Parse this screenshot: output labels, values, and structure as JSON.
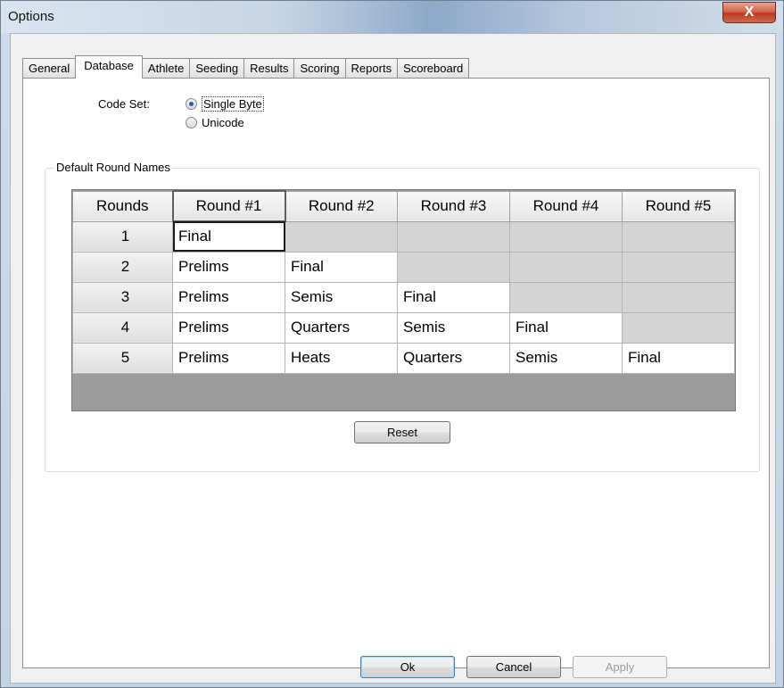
{
  "window": {
    "title": "Options",
    "close_glyph": "X"
  },
  "tabs": [
    {
      "label": "General"
    },
    {
      "label": "Database",
      "active": true
    },
    {
      "label": "Athlete"
    },
    {
      "label": "Seeding"
    },
    {
      "label": "Results"
    },
    {
      "label": "Scoring"
    },
    {
      "label": "Reports"
    },
    {
      "label": "Scoreboard"
    }
  ],
  "database": {
    "code_set_label": "Code Set:",
    "options": [
      {
        "label": "Single Byte",
        "checked": true
      },
      {
        "label": "Unicode",
        "checked": false
      }
    ],
    "group_title": "Default Round Names",
    "grid": {
      "headers": [
        "Rounds",
        "Round #1",
        "Round #2",
        "Round #3",
        "Round #4",
        "Round #5"
      ],
      "rows": [
        {
          "rounds": "1",
          "cells": [
            "Final",
            "",
            "",
            "",
            ""
          ]
        },
        {
          "rounds": "2",
          "cells": [
            "Prelims",
            "Final",
            "",
            "",
            ""
          ]
        },
        {
          "rounds": "3",
          "cells": [
            "Prelims",
            "Semis",
            "Final",
            "",
            ""
          ]
        },
        {
          "rounds": "4",
          "cells": [
            "Prelims",
            "Quarters",
            "Semis",
            "Final",
            ""
          ]
        },
        {
          "rounds": "5",
          "cells": [
            "Prelims",
            "Heats",
            "Quarters",
            "Semis",
            "Final"
          ]
        }
      ]
    },
    "reset_label": "Reset"
  },
  "footer": {
    "ok_label": "Ok",
    "cancel_label": "Cancel",
    "apply_label": "Apply"
  }
}
